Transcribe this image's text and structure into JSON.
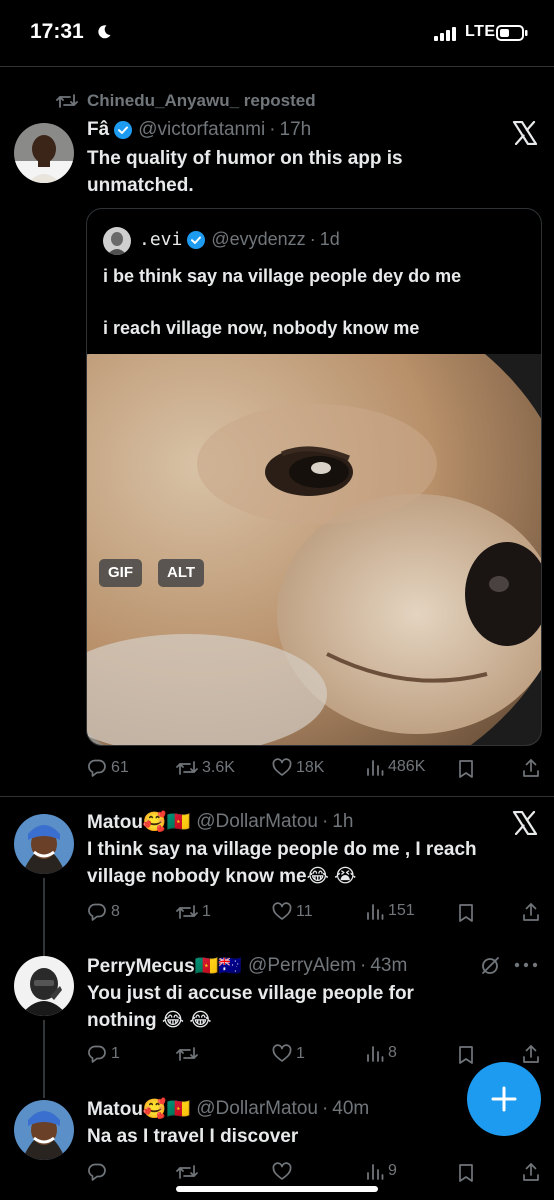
{
  "status": {
    "time": "17:31",
    "network": "LTE"
  },
  "repost": {
    "text": "Chinedu_Anyawu_ reposted"
  },
  "main_tweet": {
    "name": "Fâ",
    "handle": "@victorfatanmi",
    "time": "17h",
    "text": "The quality of humor on this app is unmatched.",
    "quote": {
      "name": ".evi",
      "handle": "@evydenzz",
      "time": "1d",
      "line1": "i be think say na village people dey do me",
      "line2": "i reach village now, nobody know me",
      "gif_label": "GIF",
      "alt_label": "ALT"
    },
    "stats": {
      "replies": "61",
      "reposts": "3.6K",
      "likes": "18K",
      "views": "486K"
    }
  },
  "replies": [
    {
      "name": "Matou🥰🇨🇲",
      "handle": "@DollarMatou",
      "time": "1h",
      "text": "I think say na village people do me , I reach village nobody know me😂 😭",
      "stats": {
        "replies": "8",
        "reposts": "1",
        "likes": "11",
        "views": "151"
      }
    },
    {
      "name": "PerryMecus🇨🇲🇦🇺",
      "handle": "@PerryAlem",
      "time": "43m",
      "text": "You just di accuse village people for nothing 😂 😂",
      "stats": {
        "replies": "1",
        "reposts": "",
        "likes": "1",
        "views": "8"
      }
    },
    {
      "name": "Matou🥰🇨🇲",
      "handle": "@DollarMatou",
      "time": "40m",
      "text": "Na as I travel I discover",
      "stats": {
        "replies": "",
        "reposts": "",
        "likes": "",
        "views": "9"
      }
    }
  ],
  "colors": {
    "accent": "#1d9bf0",
    "muted": "#71767b",
    "background": "#000000",
    "divider": "#2f3336"
  }
}
